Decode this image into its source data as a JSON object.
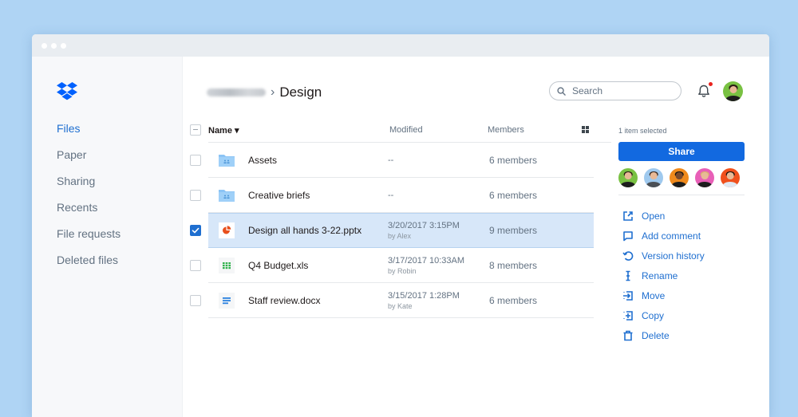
{
  "window": {
    "titlebar_dots": 3
  },
  "sidebar": {
    "logo": "dropbox-logo",
    "items": [
      {
        "label": "Files",
        "active": true
      },
      {
        "label": "Paper",
        "active": false
      },
      {
        "label": "Sharing",
        "active": false
      },
      {
        "label": "Recents",
        "active": false
      },
      {
        "label": "File requests",
        "active": false
      },
      {
        "label": "Deleted files",
        "active": false
      }
    ]
  },
  "header": {
    "breadcrumb": {
      "parent_label": "(blurred)",
      "separator": "›",
      "current": "Design"
    },
    "search": {
      "placeholder": "Search",
      "value": ""
    },
    "notification_unread": true
  },
  "table": {
    "columns": {
      "name": "Name ▾",
      "modified": "Modified",
      "members": "Members"
    },
    "rows": [
      {
        "name": "Assets",
        "type": "shared-folder",
        "modified": "--",
        "modified_by": "",
        "members": "6 members",
        "selected": false
      },
      {
        "name": "Creative briefs",
        "type": "shared-folder",
        "modified": "--",
        "modified_by": "",
        "members": "6 members",
        "selected": false
      },
      {
        "name": "Design all hands 3-22.pptx",
        "type": "presentation",
        "modified": "3/20/2017 3:15PM",
        "modified_by": "by Alex",
        "members": "9 members",
        "selected": true
      },
      {
        "name": "Q4 Budget.xls",
        "type": "spreadsheet",
        "modified": "3/17/2017 10:33AM",
        "modified_by": "by Robin",
        "members": "8 members",
        "selected": false
      },
      {
        "name": "Staff review.docx",
        "type": "document",
        "modified": "3/15/2017 1:28PM",
        "modified_by": "by Kate",
        "members": "6 members",
        "selected": false
      }
    ]
  },
  "panel": {
    "selection_text": "1 item selected",
    "share_label": "Share",
    "member_avatars": [
      {
        "name": "member-1",
        "bg": "#79c142"
      },
      {
        "name": "member-2",
        "bg": "#9fc9ee"
      },
      {
        "name": "member-3",
        "bg": "#f08a1c"
      },
      {
        "name": "member-4",
        "bg": "#e85fb7"
      },
      {
        "name": "member-5",
        "bg": "#f0501c"
      }
    ],
    "actions": [
      {
        "label": "Open",
        "icon": "open-external-icon"
      },
      {
        "label": "Add comment",
        "icon": "comment-icon"
      },
      {
        "label": "Version history",
        "icon": "version-history-icon"
      },
      {
        "label": "Rename",
        "icon": "rename-icon"
      },
      {
        "label": "Move",
        "icon": "move-icon"
      },
      {
        "label": "Copy",
        "icon": "copy-icon"
      },
      {
        "label": "Delete",
        "icon": "trash-icon"
      }
    ]
  },
  "colors": {
    "background": "#afd4f4",
    "accent": "#1f6fd0",
    "share_button": "#1269e0",
    "selected_row": "#d7e7f9",
    "folder": "#8cc4f5",
    "pptx": "#e8501e",
    "xls": "#2fb14b",
    "docx": "#2b82e0",
    "notification": "#e9231e"
  }
}
